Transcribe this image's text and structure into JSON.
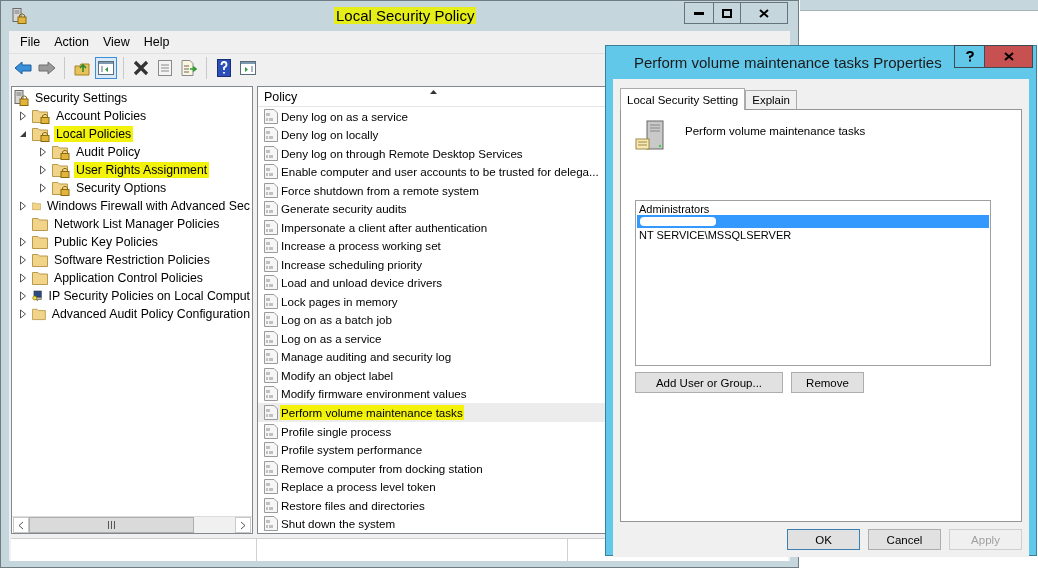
{
  "window": {
    "title": "Local Security Policy",
    "title_highlighted": true
  },
  "menu": [
    "File",
    "Action",
    "View",
    "Help"
  ],
  "toolbar": [
    [
      {
        "kind": "back",
        "pressed": false
      },
      {
        "kind": "forward",
        "pressed": false
      }
    ],
    [
      {
        "kind": "up",
        "pressed": false
      },
      {
        "kind": "tree",
        "pressed": true
      }
    ],
    [
      {
        "kind": "delete",
        "pressed": false
      },
      {
        "kind": "properties",
        "pressed": false
      },
      {
        "kind": "export",
        "pressed": false
      }
    ],
    [
      {
        "kind": "help",
        "pressed": false
      },
      {
        "kind": "actionpane",
        "pressed": false
      }
    ]
  ],
  "tree": {
    "label": "Security Settings",
    "kind": "root",
    "highlighted": false,
    "children": [
      {
        "label": "Account Policies",
        "kind": "lockfolder",
        "expandable": true,
        "expanded": false,
        "highlighted": false
      },
      {
        "label": "Local Policies",
        "kind": "lockfolder",
        "expandable": true,
        "expanded": true,
        "highlighted": true,
        "children": [
          {
            "label": "Audit Policy",
            "kind": "lockfolder",
            "expandable": true,
            "expanded": false,
            "highlighted": false
          },
          {
            "label": "User Rights Assignment",
            "kind": "lockfolder",
            "expandable": true,
            "expanded": false,
            "highlighted": true
          },
          {
            "label": "Security Options",
            "kind": "lockfolder",
            "expandable": true,
            "expanded": false,
            "highlighted": false
          }
        ]
      },
      {
        "label": "Windows Firewall with Advanced Sec",
        "kind": "folder",
        "expandable": true,
        "expanded": false,
        "highlighted": false
      },
      {
        "label": "Network List Manager Policies",
        "kind": "folder",
        "expandable": false,
        "highlighted": false
      },
      {
        "label": "Public Key Policies",
        "kind": "folder",
        "expandable": true,
        "expanded": false,
        "highlighted": false
      },
      {
        "label": "Software Restriction Policies",
        "kind": "folder",
        "expandable": true,
        "expanded": false,
        "highlighted": false
      },
      {
        "label": "Application Control Policies",
        "kind": "folder",
        "expandable": true,
        "expanded": false,
        "highlighted": false
      },
      {
        "label": "IP Security Policies on Local Comput",
        "kind": "ipsec",
        "expandable": true,
        "expanded": false,
        "highlighted": false
      },
      {
        "label": "Advanced Audit Policy Configuration",
        "kind": "folder",
        "expandable": true,
        "expanded": false,
        "highlighted": false
      }
    ]
  },
  "policy_column": "Policy",
  "policies": [
    {
      "label": "Deny log on as a service",
      "selected": false,
      "highlighted": false
    },
    {
      "label": "Deny log on locally",
      "selected": false,
      "highlighted": false
    },
    {
      "label": "Deny log on through Remote Desktop Services",
      "selected": false,
      "highlighted": false
    },
    {
      "label": "Enable computer and user accounts to be trusted for delega...",
      "selected": false,
      "highlighted": false
    },
    {
      "label": "Force shutdown from a remote system",
      "selected": false,
      "highlighted": false
    },
    {
      "label": "Generate security audits",
      "selected": false,
      "highlighted": false
    },
    {
      "label": "Impersonate a client after authentication",
      "selected": false,
      "highlighted": false
    },
    {
      "label": "Increase a process working set",
      "selected": false,
      "highlighted": false
    },
    {
      "label": "Increase scheduling priority",
      "selected": false,
      "highlighted": false
    },
    {
      "label": "Load and unload device drivers",
      "selected": false,
      "highlighted": false
    },
    {
      "label": "Lock pages in memory",
      "selected": false,
      "highlighted": false
    },
    {
      "label": "Log on as a batch job",
      "selected": false,
      "highlighted": false
    },
    {
      "label": "Log on as a service",
      "selected": false,
      "highlighted": false
    },
    {
      "label": "Manage auditing and security log",
      "selected": false,
      "highlighted": false
    },
    {
      "label": "Modify an object label",
      "selected": false,
      "highlighted": false
    },
    {
      "label": "Modify firmware environment values",
      "selected": false,
      "highlighted": false
    },
    {
      "label": "Perform volume maintenance tasks",
      "selected": true,
      "highlighted": true
    },
    {
      "label": "Profile single process",
      "selected": false,
      "highlighted": false
    },
    {
      "label": "Profile system performance",
      "selected": false,
      "highlighted": false
    },
    {
      "label": "Remove computer from docking station",
      "selected": false,
      "highlighted": false
    },
    {
      "label": "Replace a process level token",
      "selected": false,
      "highlighted": false
    },
    {
      "label": "Restore files and directories",
      "selected": false,
      "highlighted": false
    },
    {
      "label": "Shut down the system",
      "selected": false,
      "highlighted": false
    }
  ],
  "dialog": {
    "title": "Perform volume maintenance tasks Properties",
    "tabs": [
      {
        "label": "Local Security Setting",
        "selected": true
      },
      {
        "label": "Explain",
        "selected": false
      }
    ],
    "policy_name": "Perform volume maintenance tasks",
    "members": [
      {
        "label": "Administrators",
        "selected": false,
        "redacted": false
      },
      {
        "selected": true,
        "redacted": true
      },
      {
        "label": "NT SERVICE\\MSSQLSERVER",
        "selected": false,
        "redacted": false
      }
    ],
    "member_buttons": [
      "Add User or Group...",
      "Remove"
    ],
    "buttons": [
      {
        "label": "OK",
        "default": true,
        "disabled": false
      },
      {
        "label": "Cancel",
        "default": false,
        "disabled": false
      },
      {
        "label": "Apply",
        "default": false,
        "disabled": true
      }
    ]
  }
}
